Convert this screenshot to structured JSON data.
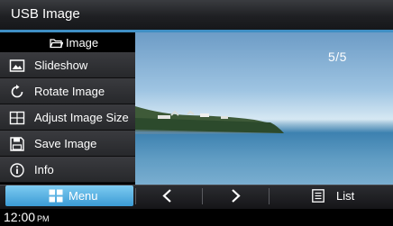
{
  "header": {
    "title": "USB Image"
  },
  "folder": {
    "icon": "folder-icon",
    "name": "Image"
  },
  "viewer": {
    "counter": "5/5"
  },
  "side_menu": {
    "items": [
      {
        "label": "Slideshow",
        "icon": "slideshow-icon"
      },
      {
        "label": "Rotate Image",
        "icon": "rotate-icon"
      },
      {
        "label": "Adjust Image Size",
        "icon": "resize-icon"
      },
      {
        "label": "Save Image",
        "icon": "save-icon"
      },
      {
        "label": "Info",
        "icon": "info-icon"
      }
    ]
  },
  "bottom": {
    "menu_label": "Menu",
    "prev_icon": "chevron-left-icon",
    "next_icon": "chevron-right-icon",
    "list_label": "List"
  },
  "status": {
    "time": "12:00",
    "ampm": "PM"
  },
  "colors": {
    "accent": "#3f8fc4",
    "menu_button": "#5bb3e4"
  }
}
